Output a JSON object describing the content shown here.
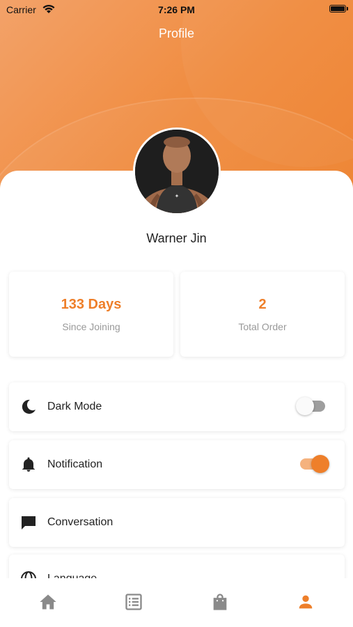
{
  "status_bar": {
    "carrier": "Carrier",
    "time": "7:26 PM"
  },
  "header": {
    "title": "Profile"
  },
  "profile": {
    "name": "Warner Jin"
  },
  "stats": [
    {
      "value": "133 Days",
      "label": "Since Joining"
    },
    {
      "value": "2",
      "label": "Total Order"
    }
  ],
  "menu": [
    {
      "label": "Dark Mode",
      "icon": "moon-icon",
      "toggle": "off"
    },
    {
      "label": "Notification",
      "icon": "bell-icon",
      "toggle": "on"
    },
    {
      "label": "Conversation",
      "icon": "chat-icon"
    },
    {
      "label": "Language",
      "icon": "globe-icon"
    }
  ],
  "tab_bar": {
    "items": [
      "home-icon",
      "list-icon",
      "bag-icon",
      "person-icon"
    ],
    "active": "person-icon"
  },
  "colors": {
    "accent": "#ee7f2a",
    "muted_icon": "#8a8a8a"
  }
}
